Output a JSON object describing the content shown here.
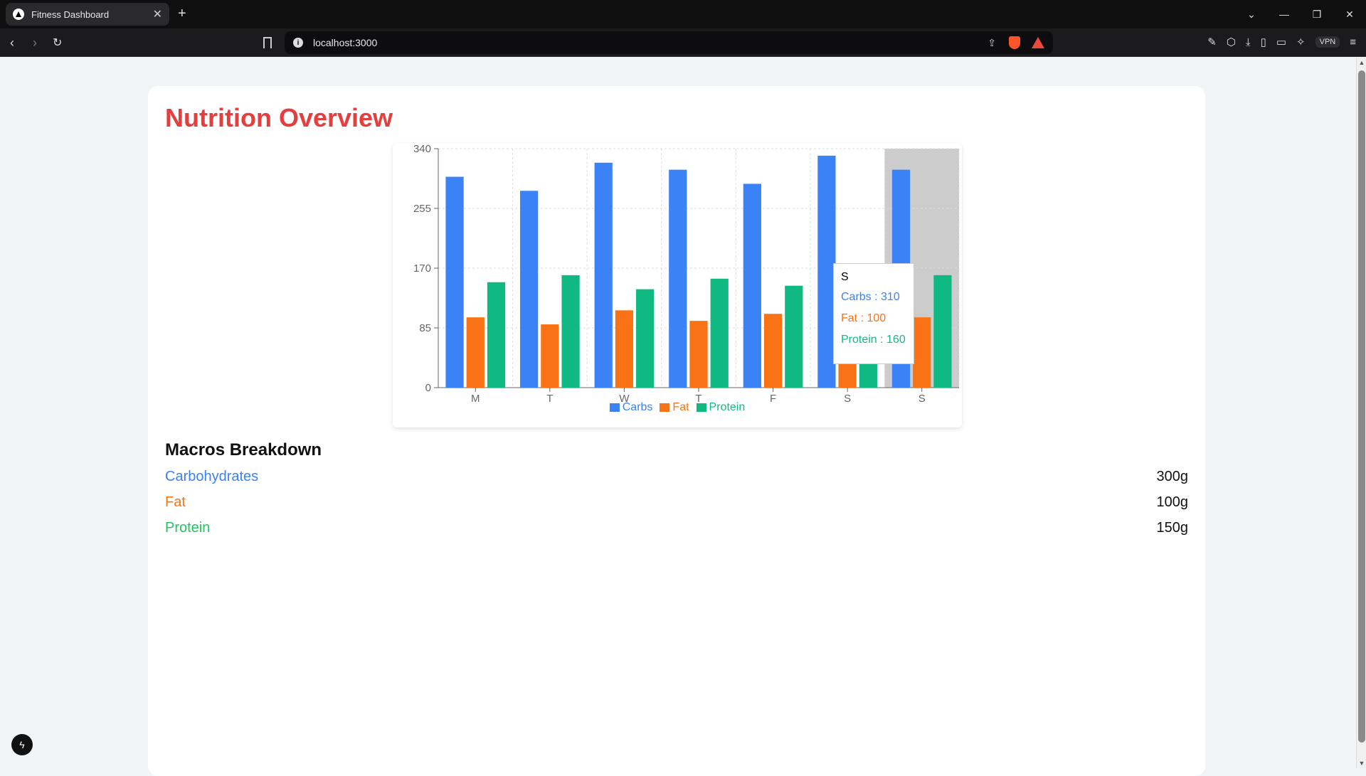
{
  "browser": {
    "tab_title": "Fitness Dashboard",
    "new_tab": "+",
    "url": "localhost:3000",
    "vpn": "VPN"
  },
  "page": {
    "title": "Nutrition Overview",
    "macros_title": "Macros Breakdown",
    "macros": [
      {
        "label": "Carbohydrates",
        "value": "300g",
        "color": "#3b82f6"
      },
      {
        "label": "Fat",
        "value": "100g",
        "color": "#f97316"
      },
      {
        "label": "Protein",
        "value": "150g",
        "color": "#22c55e"
      }
    ]
  },
  "chart_data": {
    "type": "bar",
    "categories": [
      "M",
      "T",
      "W",
      "T",
      "F",
      "S",
      "S"
    ],
    "series": [
      {
        "name": "Carbs",
        "color": "#3b82f6",
        "values": [
          300,
          280,
          320,
          310,
          290,
          330,
          310
        ]
      },
      {
        "name": "Fat",
        "color": "#f97316",
        "values": [
          100,
          90,
          110,
          95,
          105,
          115,
          100
        ]
      },
      {
        "name": "Protein",
        "color": "#10b981",
        "values": [
          150,
          160,
          140,
          155,
          145,
          150,
          160
        ]
      }
    ],
    "ylim": [
      0,
      340
    ],
    "yticks": [
      0,
      85,
      170,
      255,
      340
    ],
    "grid": true,
    "legend": "bottom",
    "highlighted_category_index": 6,
    "tooltip": {
      "title": "S",
      "rows": [
        {
          "label": "Carbs : 310",
          "color": "#3b82f6"
        },
        {
          "label": "Fat : 100",
          "color": "#f97316"
        },
        {
          "label": "Protein : 160",
          "color": "#10b981"
        }
      ]
    }
  }
}
